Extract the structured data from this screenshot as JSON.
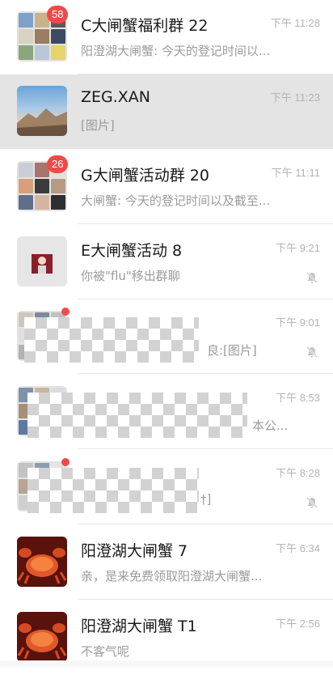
{
  "conversations": [
    {
      "title": "C大闸蟹福利群 22",
      "preview": "阳澄湖大闸蟹: 今天的登记时间以...",
      "time": "下午 11:28",
      "badge": "58",
      "muted": false
    },
    {
      "title": "ZEG.XAN",
      "preview": "[图片]",
      "time": "下午 11:23",
      "badge": "",
      "muted": false,
      "selected": true
    },
    {
      "title": "G大闸蟹活动群 20",
      "preview": "大闸蟹: 今天的登记时间以及截至...",
      "time": "下午 11:11",
      "badge": "26",
      "muted": false
    },
    {
      "title": "E大闸蟹活动 8",
      "preview": "你被\"flu\"移出群聊",
      "time": "下午 9:21",
      "badge": "",
      "muted": true
    },
    {
      "title": "",
      "preview": "良:[图片]",
      "time": "下午 9:01",
      "badge": "",
      "dot": true,
      "muted": true,
      "obscured": true
    },
    {
      "title": "",
      "preview": "本公...",
      "time": "下午 8:53",
      "badge": "",
      "muted": false,
      "obscured": true
    },
    {
      "title": "",
      "preview": "†]",
      "time": "下午 8:28",
      "badge": "",
      "dot": true,
      "muted": true,
      "obscured": true
    },
    {
      "title": "阳澄湖大闸蟹 7",
      "preview": "亲，是来免费领取阳澄湖大闸蟹...",
      "time": "下午 6:34",
      "badge": "",
      "muted": false
    },
    {
      "title": "阳澄湖大闸蟹 T1",
      "preview": "不客气呢",
      "time": "下午 2:56",
      "badge": "",
      "muted": false
    }
  ],
  "icons": {
    "mute": "bell-slash-icon"
  },
  "colors": {
    "badge": "#f04a48",
    "selected_row": "#e4e4e4",
    "time": "#b3b3b3",
    "preview": "#9b9b9b"
  }
}
